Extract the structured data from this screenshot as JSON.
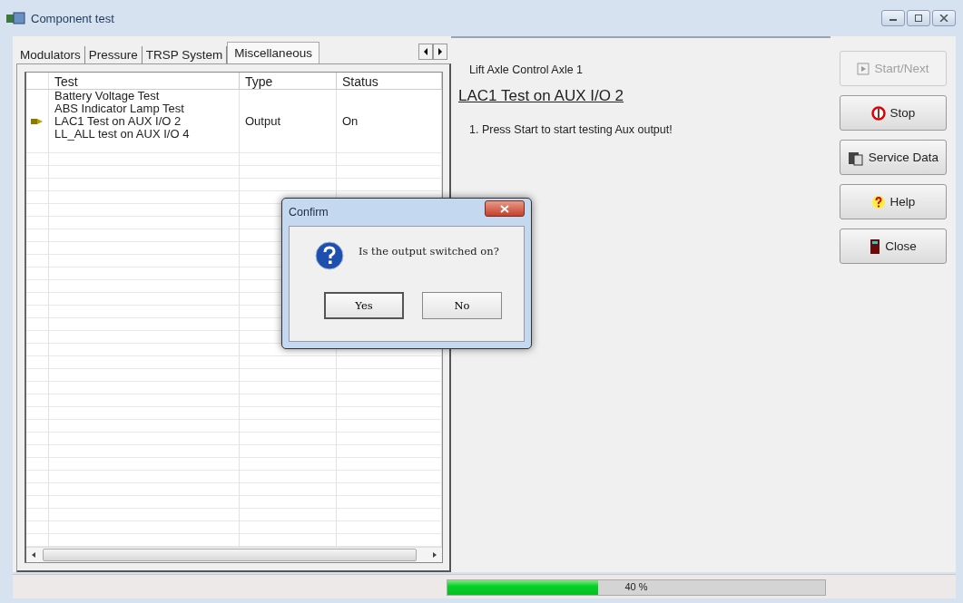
{
  "window": {
    "title": "Component test"
  },
  "tabs": [
    {
      "label": "Modulators",
      "selected": false
    },
    {
      "label": "Pressure",
      "selected": false
    },
    {
      "label": "TRSP System",
      "selected": false
    },
    {
      "label": "Miscellaneous",
      "selected": true
    }
  ],
  "table": {
    "columns": [
      "Test",
      "Type",
      "Status"
    ],
    "rows": [
      {
        "cells": [
          "Battery Voltage Test",
          "",
          ""
        ],
        "current": false
      },
      {
        "cells": [
          "ABS Indicator Lamp Test",
          "",
          ""
        ],
        "current": false
      },
      {
        "cells": [
          "LAC1 Test on AUX I/O 2",
          "Output",
          "On"
        ],
        "current": true
      },
      {
        "cells": [
          "LL_ALL test on AUX I/O 4",
          "",
          ""
        ],
        "current": false
      }
    ]
  },
  "detail": {
    "group": "Lift Axle Control Axle 1",
    "heading": "LAC1 Test on AUX I/O 2",
    "steps": [
      "1. Press Start to start testing Aux output!"
    ]
  },
  "buttons": [
    {
      "label": "Start/Next",
      "kind": "start",
      "disabled": true
    },
    {
      "label": "Stop",
      "kind": "stop",
      "disabled": false
    },
    {
      "label": "Service Data",
      "kind": "data",
      "disabled": false
    },
    {
      "label": "Help",
      "kind": "help",
      "disabled": false
    },
    {
      "label": "Close",
      "kind": "close",
      "disabled": false
    }
  ],
  "progress": {
    "level": 0.4,
    "reading": "40 %"
  },
  "dialog": {
    "title": "Confirm",
    "message": "Is the output switched on?",
    "buttons": [
      "Yes",
      "No"
    ]
  }
}
